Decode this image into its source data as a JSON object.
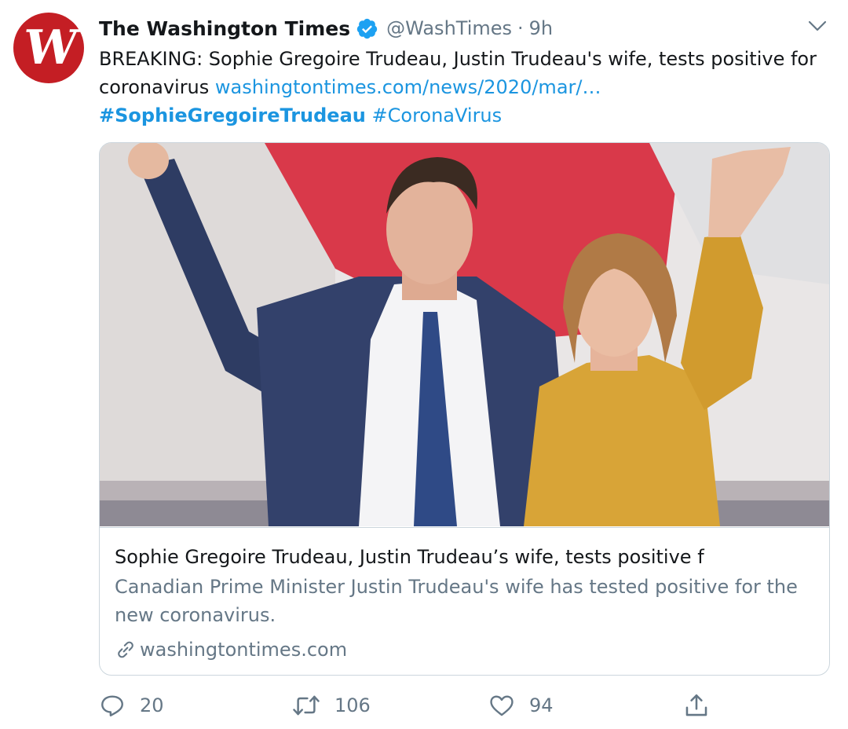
{
  "tweet": {
    "author": {
      "display_name": "The Washington Times",
      "handle": "@WashTimes",
      "avatar_letter": "W",
      "verified": true
    },
    "separator": "·",
    "timestamp": "9h",
    "text_before_link": "BREAKING: Sophie Gregoire Trudeau, Justin Trudeau's wife, tests positive for coronavirus ",
    "link_text": "washingtontimes.com/news/2020/mar/…",
    "hashtags": [
      "#SophieGregoireTrudeau",
      "#CoronaVirus"
    ]
  },
  "card": {
    "title": "Sophie Gregoire Trudeau, Justin Trudeau’s wife, tests positive f",
    "description": "Canadian Prime Minister Justin Trudeau's wife has tested positive for the new coronavirus.",
    "domain": "washingtontimes.com"
  },
  "actions": {
    "reply_count": "20",
    "retweet_count": "106",
    "like_count": "94"
  },
  "colors": {
    "link": "#1b95e0",
    "secondary_text": "#657786",
    "avatar_bg": "#c41e24",
    "verified": "#1da1f2",
    "border": "#ccd6dd"
  },
  "icons": {
    "verified": "verified-badge-icon",
    "caret": "chevron-down-icon",
    "link": "link-icon",
    "reply": "reply-icon",
    "retweet": "retweet-icon",
    "like": "heart-icon",
    "share": "share-icon"
  }
}
